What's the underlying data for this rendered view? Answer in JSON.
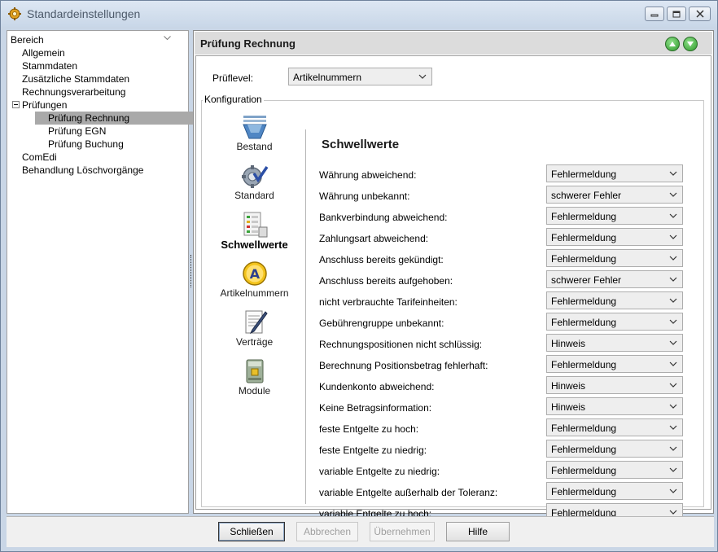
{
  "window": {
    "title": "Standardeinstellungen"
  },
  "tree": {
    "header": "Bereich",
    "items": [
      {
        "label": "Allgemein",
        "level": 1
      },
      {
        "label": "Stammdaten",
        "level": 1
      },
      {
        "label": "Zusätzliche Stammdaten",
        "level": 1
      },
      {
        "label": "Rechnungsverarbeitung",
        "level": 1
      },
      {
        "label": "Prüfungen",
        "level": 1
      },
      {
        "label": "Prüfung Rechnung",
        "level": 2,
        "selected": true
      },
      {
        "label": "Prüfung EGN",
        "level": 2
      },
      {
        "label": "Prüfung Buchung",
        "level": 2
      },
      {
        "label": "ComEdi",
        "level": 1
      },
      {
        "label": "Behandlung Löschvorgänge",
        "level": 1
      }
    ]
  },
  "panel": {
    "title": "Prüfung Rechnung",
    "pruflevel_label": "Prüflevel:",
    "pruflevel_value": "Artikelnummern",
    "konfiguration_label": "Konfiguration",
    "section_title": "Schwellwerte"
  },
  "icons": [
    {
      "label": "Bestand",
      "icon": "stack-icon"
    },
    {
      "label": "Standard",
      "icon": "gear-check-icon"
    },
    {
      "label": "Schwellwerte",
      "icon": "threshold-table-icon",
      "active": true
    },
    {
      "label": "Artikelnummern",
      "icon": "letter-a-icon"
    },
    {
      "label": "Verträge",
      "icon": "document-pen-icon"
    },
    {
      "label": "Module",
      "icon": "module-box-icon"
    }
  ],
  "rows": [
    {
      "label": "Währung abweichend:",
      "value": "Fehlermeldung"
    },
    {
      "label": "Währung unbekannt:",
      "value": "schwerer Fehler"
    },
    {
      "label": "Bankverbindung abweichend:",
      "value": "Fehlermeldung"
    },
    {
      "label": "Zahlungsart abweichend:",
      "value": "Fehlermeldung"
    },
    {
      "label": "Anschluss bereits gekündigt:",
      "value": "Fehlermeldung"
    },
    {
      "label": "Anschluss bereits aufgehoben:",
      "value": "schwerer Fehler"
    },
    {
      "label": "nicht verbrauchte Tarifeinheiten:",
      "value": "Fehlermeldung"
    },
    {
      "label": "Gebührengruppe unbekannt:",
      "value": "Fehlermeldung"
    },
    {
      "label": "Rechnungspositionen nicht schlüssig:",
      "value": "Hinweis"
    },
    {
      "label": "Berechnung Positionsbetrag fehlerhaft:",
      "value": "Fehlermeldung"
    },
    {
      "label": "Kundenkonto abweichend:",
      "value": "Hinweis"
    },
    {
      "label": "Keine Betragsinformation:",
      "value": "Hinweis"
    },
    {
      "label": "feste Entgelte zu hoch:",
      "value": "Fehlermeldung"
    },
    {
      "label": "feste Entgelte zu niedrig:",
      "value": "Fehlermeldung"
    },
    {
      "label": "variable Entgelte zu niedrig:",
      "value": "Fehlermeldung"
    },
    {
      "label": "variable Entgelte außerhalb der Toleranz:",
      "value": "Fehlermeldung"
    },
    {
      "label": "variable Entgelte zu hoch:",
      "value": "Fehlermeldung"
    }
  ],
  "buttons": {
    "close": "Schließen",
    "cancel": "Abbrechen",
    "apply": "Übernehmen",
    "help": "Hilfe"
  },
  "colors": {
    "selection": "#a9a9a9",
    "nav_green": "#2e9a2b",
    "combo_bg": "#eeeeee"
  }
}
